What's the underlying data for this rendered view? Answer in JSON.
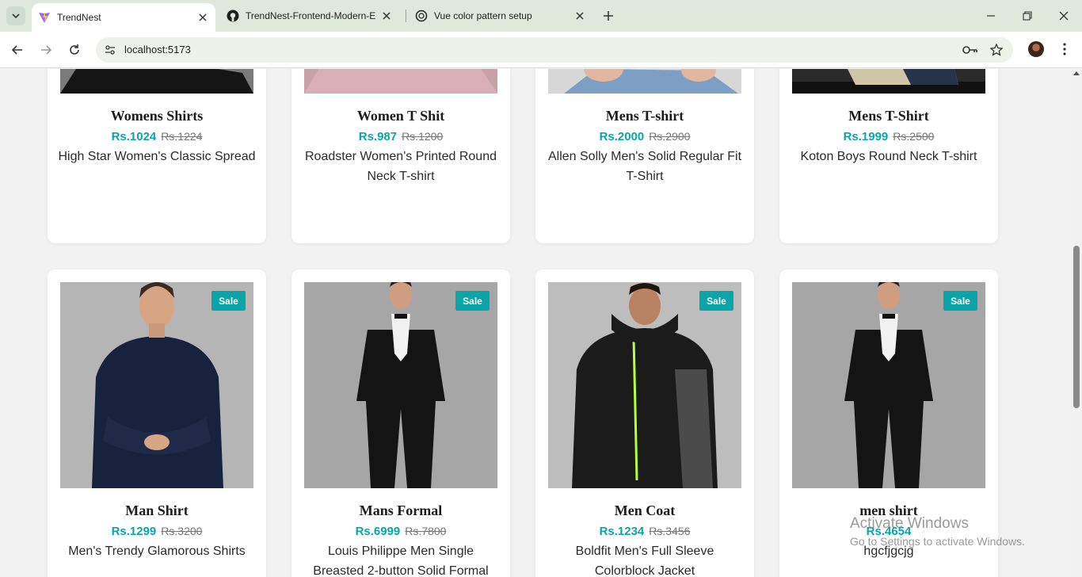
{
  "browser": {
    "tabs": [
      {
        "title": "TrendNest",
        "favicon": "vite-icon",
        "active": true
      },
      {
        "title": "TrendNest-Frontend-Modern-E",
        "favicon": "github-icon",
        "active": false
      },
      {
        "title": "Vue color pattern setup",
        "favicon": "chatgpt-icon",
        "active": false
      }
    ],
    "url": "localhost:5173"
  },
  "products_top": [
    {
      "name": "Womens Shirts",
      "price": "Rs.1024",
      "old_price": "Rs.1224",
      "desc": "High Star Women's Classic Spread"
    },
    {
      "name": "Women T Shit",
      "price": "Rs.987",
      "old_price": "Rs.1200",
      "desc": "Roadster Women's Printed Round Neck T-shirt"
    },
    {
      "name": "Mens T-shirt",
      "price": "Rs.2000",
      "old_price": "Rs.2900",
      "desc": "Allen Solly Men's Solid Regular Fit T-Shirt"
    },
    {
      "name": "Mens T-Shirt",
      "price": "Rs.1999",
      "old_price": "Rs.2500",
      "desc": "Koton Boys Round Neck T-shirt"
    }
  ],
  "products_bottom": [
    {
      "badge": "Sale",
      "name": "Man Shirt",
      "price": "Rs.1299",
      "old_price": "Rs.3200",
      "desc": "Men's Trendy Glamorous Shirts"
    },
    {
      "badge": "Sale",
      "name": "Mans Formal",
      "price": "Rs.6999",
      "old_price": "Rs.7800",
      "desc": "Louis Philippe Men Single Breasted 2-button Solid Formal"
    },
    {
      "badge": "Sale",
      "name": "Men Coat",
      "price": "Rs.1234",
      "old_price": "Rs.3456",
      "desc": "Boldfit Men's Full Sleeve Colorblock Jacket"
    },
    {
      "badge": "Sale",
      "name": "men shirt",
      "price": "Rs.4654",
      "old_price": "",
      "desc": "hgcfjgcjg"
    }
  ],
  "watermark": {
    "line1": "Activate Windows",
    "line2": "Go to Settings to activate Windows."
  },
  "colors": {
    "accent": "#0aa5a8"
  }
}
